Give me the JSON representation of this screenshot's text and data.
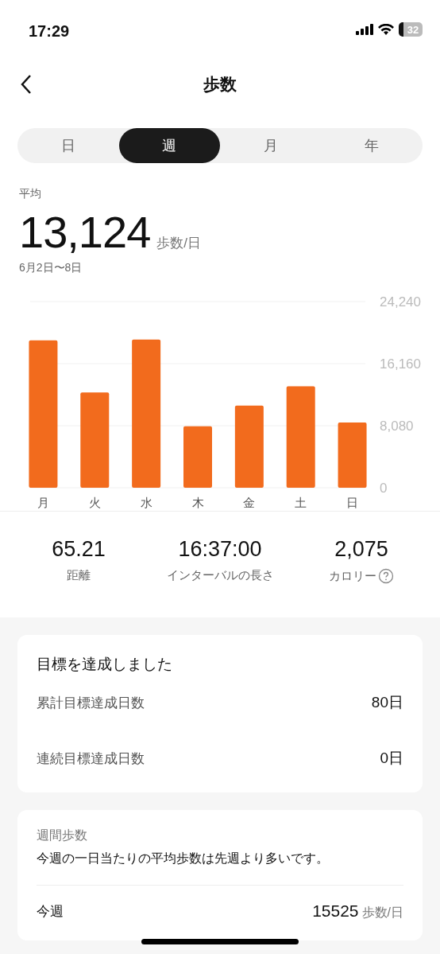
{
  "status_bar": {
    "time": "17:29",
    "battery": "32"
  },
  "nav": {
    "title": "歩数"
  },
  "tabs": [
    {
      "label": "日",
      "selected": false
    },
    {
      "label": "週",
      "selected": true
    },
    {
      "label": "月",
      "selected": false
    },
    {
      "label": "年",
      "selected": false
    }
  ],
  "summary": {
    "label": "平均",
    "value": "13,124",
    "unit": "歩数/日",
    "range": "6月2日〜8日"
  },
  "chart": {
    "chart_data": {
      "type": "bar",
      "categories": [
        "月",
        "火",
        "水",
        "木",
        "金",
        "土",
        "日"
      ],
      "series": [
        {
          "color": "#f26b1d",
          "values": [
            19200,
            12400,
            19300,
            8000,
            10700,
            13200,
            8500
          ]
        }
      ],
      "ylim": [
        0,
        24240
      ],
      "yticks": [
        {
          "value": 0,
          "label": "0"
        },
        {
          "value": 8080,
          "label": "8,080"
        },
        {
          "value": 16160,
          "label": "16,160"
        },
        {
          "value": 24240,
          "label": "24,240"
        }
      ]
    }
  },
  "stats": [
    {
      "value": "65.21",
      "label": "距離",
      "help": false
    },
    {
      "value": "16:37:00",
      "label": "インターバルの長さ",
      "help": false
    },
    {
      "value": "2,075",
      "label": "カロリー",
      "help": true
    }
  ],
  "goal_card": {
    "title": "目標を達成しました",
    "rows": [
      {
        "label": "累計目標達成日数",
        "value": "80日"
      },
      {
        "label": "連続目標達成日数",
        "value": "0日"
      }
    ]
  },
  "weekly_card": {
    "title": "週間歩数",
    "message": "今週の一日当たりの平均歩数は先週より多いです。",
    "rows": [
      {
        "label": "今週",
        "value": "15525",
        "unit": "歩数/日"
      }
    ]
  }
}
